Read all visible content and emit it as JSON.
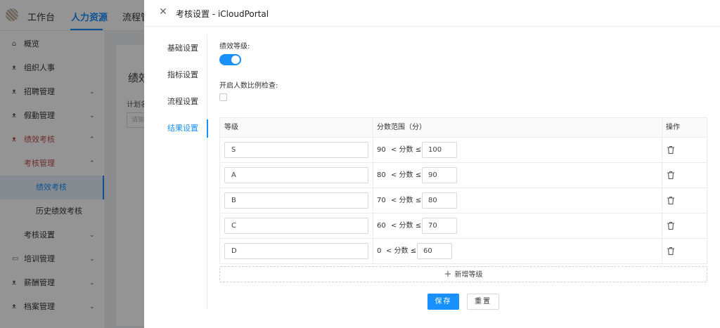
{
  "app": {
    "nav": [
      "工作台",
      "人力资源",
      "流程管"
    ],
    "sidebar": [
      {
        "label": "概览",
        "icon": "home-icon",
        "glyph": "⌂",
        "chev": ""
      },
      {
        "label": "组织人事",
        "icon": "people-icon",
        "glyph": "ᴥ",
        "chev": ""
      },
      {
        "label": "招聘管理",
        "icon": "people-icon",
        "glyph": "ᴥ",
        "chev": "⌄"
      },
      {
        "label": "假勤管理",
        "icon": "people-icon",
        "glyph": "ᴥ",
        "chev": "⌄"
      },
      {
        "label": "绩效考核",
        "icon": "people-icon",
        "glyph": "ᴥ",
        "chev": "⌃"
      },
      {
        "label": "考核管理",
        "icon": "",
        "glyph": "",
        "chev": "⌃"
      },
      {
        "label": "绩效考核",
        "icon": "",
        "glyph": "",
        "chev": ""
      },
      {
        "label": "历史绩效考核",
        "icon": "",
        "glyph": "",
        "chev": ""
      },
      {
        "label": "考核设置",
        "icon": "",
        "glyph": "",
        "chev": "⌄"
      },
      {
        "label": "培训管理",
        "icon": "book-icon",
        "glyph": "▭",
        "chev": "⌄"
      },
      {
        "label": "薪酬管理",
        "icon": "people-icon",
        "glyph": "ᴥ",
        "chev": "⌄"
      },
      {
        "label": "档案管理",
        "icon": "people-icon",
        "glyph": "ᴥ",
        "chev": "⌄"
      }
    ],
    "bg_title": "绩效",
    "bg_label": "计划名",
    "bg_placeholder": "请输"
  },
  "drawer": {
    "title": "考核设置 - iCloudPortal",
    "close_glyph": "✕",
    "tabs": [
      "基础设置",
      "指标设置",
      "流程设置",
      "结果设置"
    ],
    "active_tab": 3,
    "perf_level_label": "绩效等级:",
    "perf_level_on": true,
    "ratio_check_label": "开启人数比例检查:",
    "ratio_check_checked": false,
    "table": {
      "headers": {
        "grade": "等级",
        "range": "分数范围（分）",
        "action": "操作"
      },
      "cond_text": "< 分数 ≤",
      "rows": [
        {
          "grade": "S",
          "lower": "90",
          "upper": "100"
        },
        {
          "grade": "A",
          "lower": "80",
          "upper": "90"
        },
        {
          "grade": "B",
          "lower": "70",
          "upper": "80"
        },
        {
          "grade": "C",
          "lower": "60",
          "upper": "70"
        },
        {
          "grade": "D",
          "lower": "0",
          "upper": "60"
        }
      ]
    },
    "add_label": "新增等级",
    "add_glyph": "+",
    "save_label": "保存",
    "reset_label": "重置"
  }
}
